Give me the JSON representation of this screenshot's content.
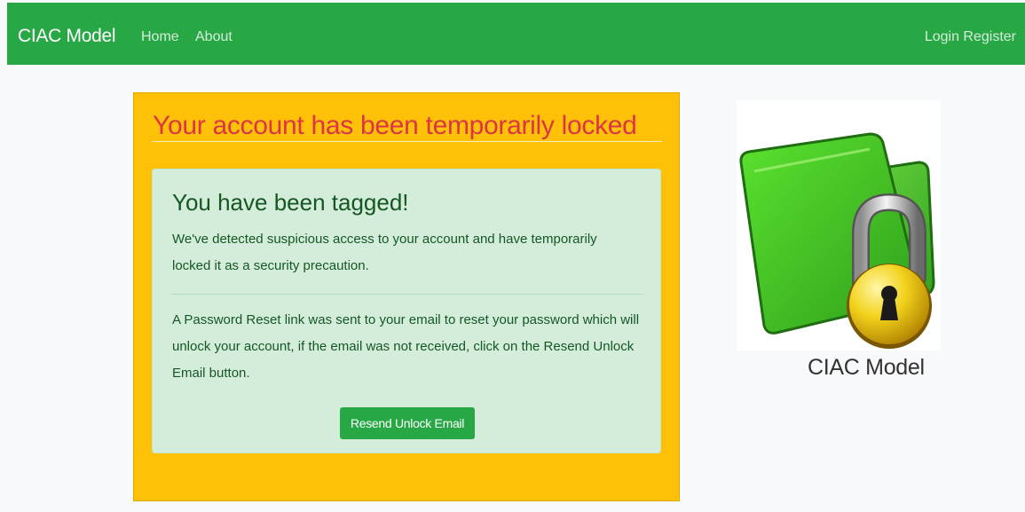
{
  "navbar": {
    "brand": "CIAC Model",
    "links": [
      {
        "label": "Home"
      },
      {
        "label": "About"
      }
    ],
    "auth": {
      "login": "Login",
      "register": "Register"
    }
  },
  "warning": {
    "title": "Your account has been temporarily locked"
  },
  "alert": {
    "heading": "You have been tagged!",
    "message": "We've detected suspicious access to your account and have temporarily locked it as a security precaution.",
    "instructions": "A Password Reset link was sent to your email to reset your password which will unlock your account, if the email was not received, click on the Resend Unlock Email button.",
    "button_label": "Resend Unlock Email"
  },
  "logo": {
    "caption": "CIAC Model",
    "icon": "locked-folder-icon"
  },
  "colors": {
    "navbar": "#28a745",
    "warning_panel": "#ffc107",
    "alert_background": "#d4edda",
    "title_red": "#dc3545",
    "button": "#28a745"
  }
}
